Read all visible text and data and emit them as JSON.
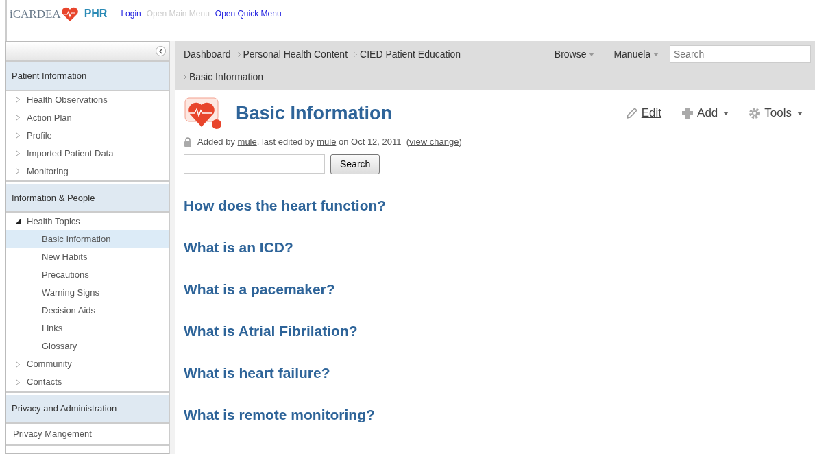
{
  "header": {
    "logo_text": "iCARDEA",
    "app_name": "PHR",
    "links": [
      {
        "label": "Login",
        "disabled": false
      },
      {
        "label": "Open Main Menu",
        "disabled": true
      },
      {
        "label": "Open Quick Menu",
        "disabled": false
      }
    ]
  },
  "sidebar": {
    "sections": [
      {
        "title": "Patient Information",
        "items": [
          {
            "label": "Health Observations",
            "kind": "node",
            "expanded": false,
            "selected": false
          },
          {
            "label": "Action Plan",
            "kind": "node",
            "expanded": false,
            "selected": false
          },
          {
            "label": "Profile",
            "kind": "node",
            "expanded": false,
            "selected": false
          },
          {
            "label": "Imported Patient Data",
            "kind": "node",
            "expanded": false,
            "selected": false
          },
          {
            "label": "Monitoring",
            "kind": "node",
            "expanded": false,
            "selected": false
          }
        ]
      },
      {
        "title": "Information & People",
        "items": [
          {
            "label": "Health Topics",
            "kind": "node",
            "expanded": true,
            "selected": false,
            "children": [
              {
                "label": "Basic Information",
                "kind": "leaf",
                "selected": true
              },
              {
                "label": "New Habits",
                "kind": "leaf",
                "selected": false
              },
              {
                "label": "Precautions",
                "kind": "leaf",
                "selected": false
              },
              {
                "label": "Warning Signs",
                "kind": "leaf",
                "selected": false
              },
              {
                "label": "Decision Aids",
                "kind": "leaf",
                "selected": false
              },
              {
                "label": "Links",
                "kind": "leaf",
                "selected": false
              },
              {
                "label": "Glossary",
                "kind": "leaf",
                "selected": false
              }
            ]
          },
          {
            "label": "Community",
            "kind": "node",
            "expanded": false,
            "selected": false
          },
          {
            "label": "Contacts",
            "kind": "node",
            "expanded": false,
            "selected": false
          }
        ]
      },
      {
        "title": "Privacy and Administration",
        "items": [
          {
            "label": "Privacy Mangement",
            "kind": "plain",
            "selected": false
          }
        ]
      }
    ]
  },
  "breadcrumbs": [
    "Dashboard",
    "Personal Health Content",
    "CIED Patient Education",
    "Basic Information"
  ],
  "top_menus": [
    "Browse",
    "Manuela"
  ],
  "top_search": {
    "placeholder": "Search"
  },
  "page": {
    "title": "Basic Information",
    "actions": [
      {
        "label": "Edit",
        "kind": "edit"
      },
      {
        "label": "Add",
        "kind": "add"
      },
      {
        "label": "Tools",
        "kind": "tools"
      }
    ],
    "meta": [
      {
        "text": "Added by ",
        "kind": "text"
      },
      {
        "text": "mule",
        "kind": "link"
      },
      {
        "text": ", last edited by ",
        "kind": "text"
      },
      {
        "text": "mule",
        "kind": "link"
      },
      {
        "text": " on Oct 12, 2011  (",
        "kind": "text"
      },
      {
        "text": "view change",
        "kind": "link"
      },
      {
        "text": ")",
        "kind": "text"
      }
    ],
    "search_button": "Search",
    "headings": [
      "How does the heart function?",
      "What is an ICD?",
      "What is a pacemaker?",
      "What is Atrial Fibrilation?",
      "What is heart failure?",
      "What is remote monitoring?"
    ]
  }
}
